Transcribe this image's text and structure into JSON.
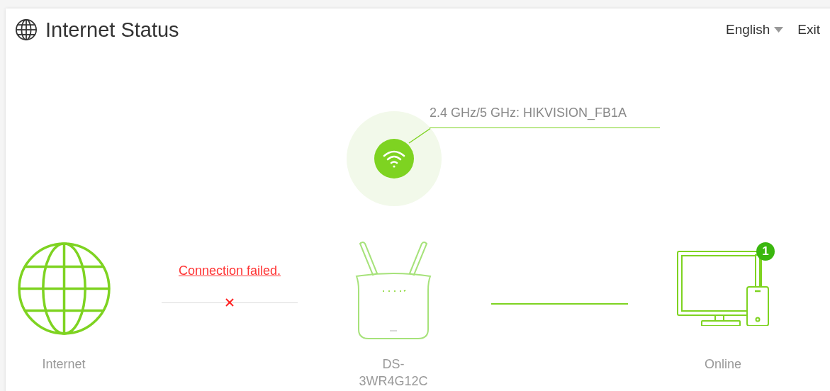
{
  "header": {
    "title": "Internet Status",
    "language": "English",
    "exit": "Exit"
  },
  "wifi": {
    "ssid_label": "2.4 GHz/5 GHz: HIKVISION_FB1A"
  },
  "internet": {
    "label": "Internet"
  },
  "wan_link": {
    "status": "Connection failed.",
    "connected": false
  },
  "router": {
    "label": "DS-3WR4G12C"
  },
  "lan_link": {
    "connected": true
  },
  "clients": {
    "count": "1",
    "label": "Online"
  }
}
